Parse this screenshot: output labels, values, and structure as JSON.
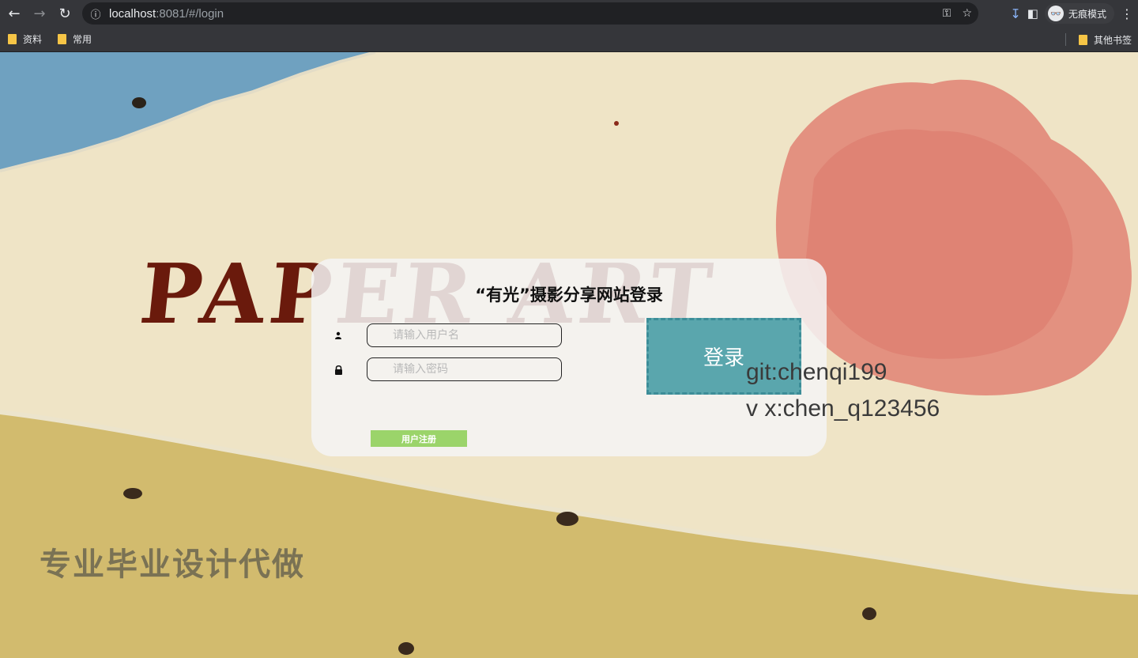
{
  "browser": {
    "url_host": "localhost",
    "url_rest": ":8081/#/login",
    "profile_label": "无痕模式",
    "profile_avatar": "👓"
  },
  "bookmarks": {
    "items": [
      "资料",
      "常用"
    ],
    "other": "其他书签"
  },
  "page": {
    "brand_text": "PAPER ART",
    "watermark": "专业毕业设计代做",
    "login": {
      "title": "“有光”摄影分享网站登录",
      "username_placeholder": "请输入用户名",
      "password_placeholder": "请输入密码",
      "login_label": "登录",
      "register_label": "用户注册"
    },
    "contact": {
      "git": "git:chenqi199",
      "vx": "v x:chen_q123456"
    }
  },
  "icons": {
    "user": "user-icon",
    "lock": "lock-icon"
  }
}
